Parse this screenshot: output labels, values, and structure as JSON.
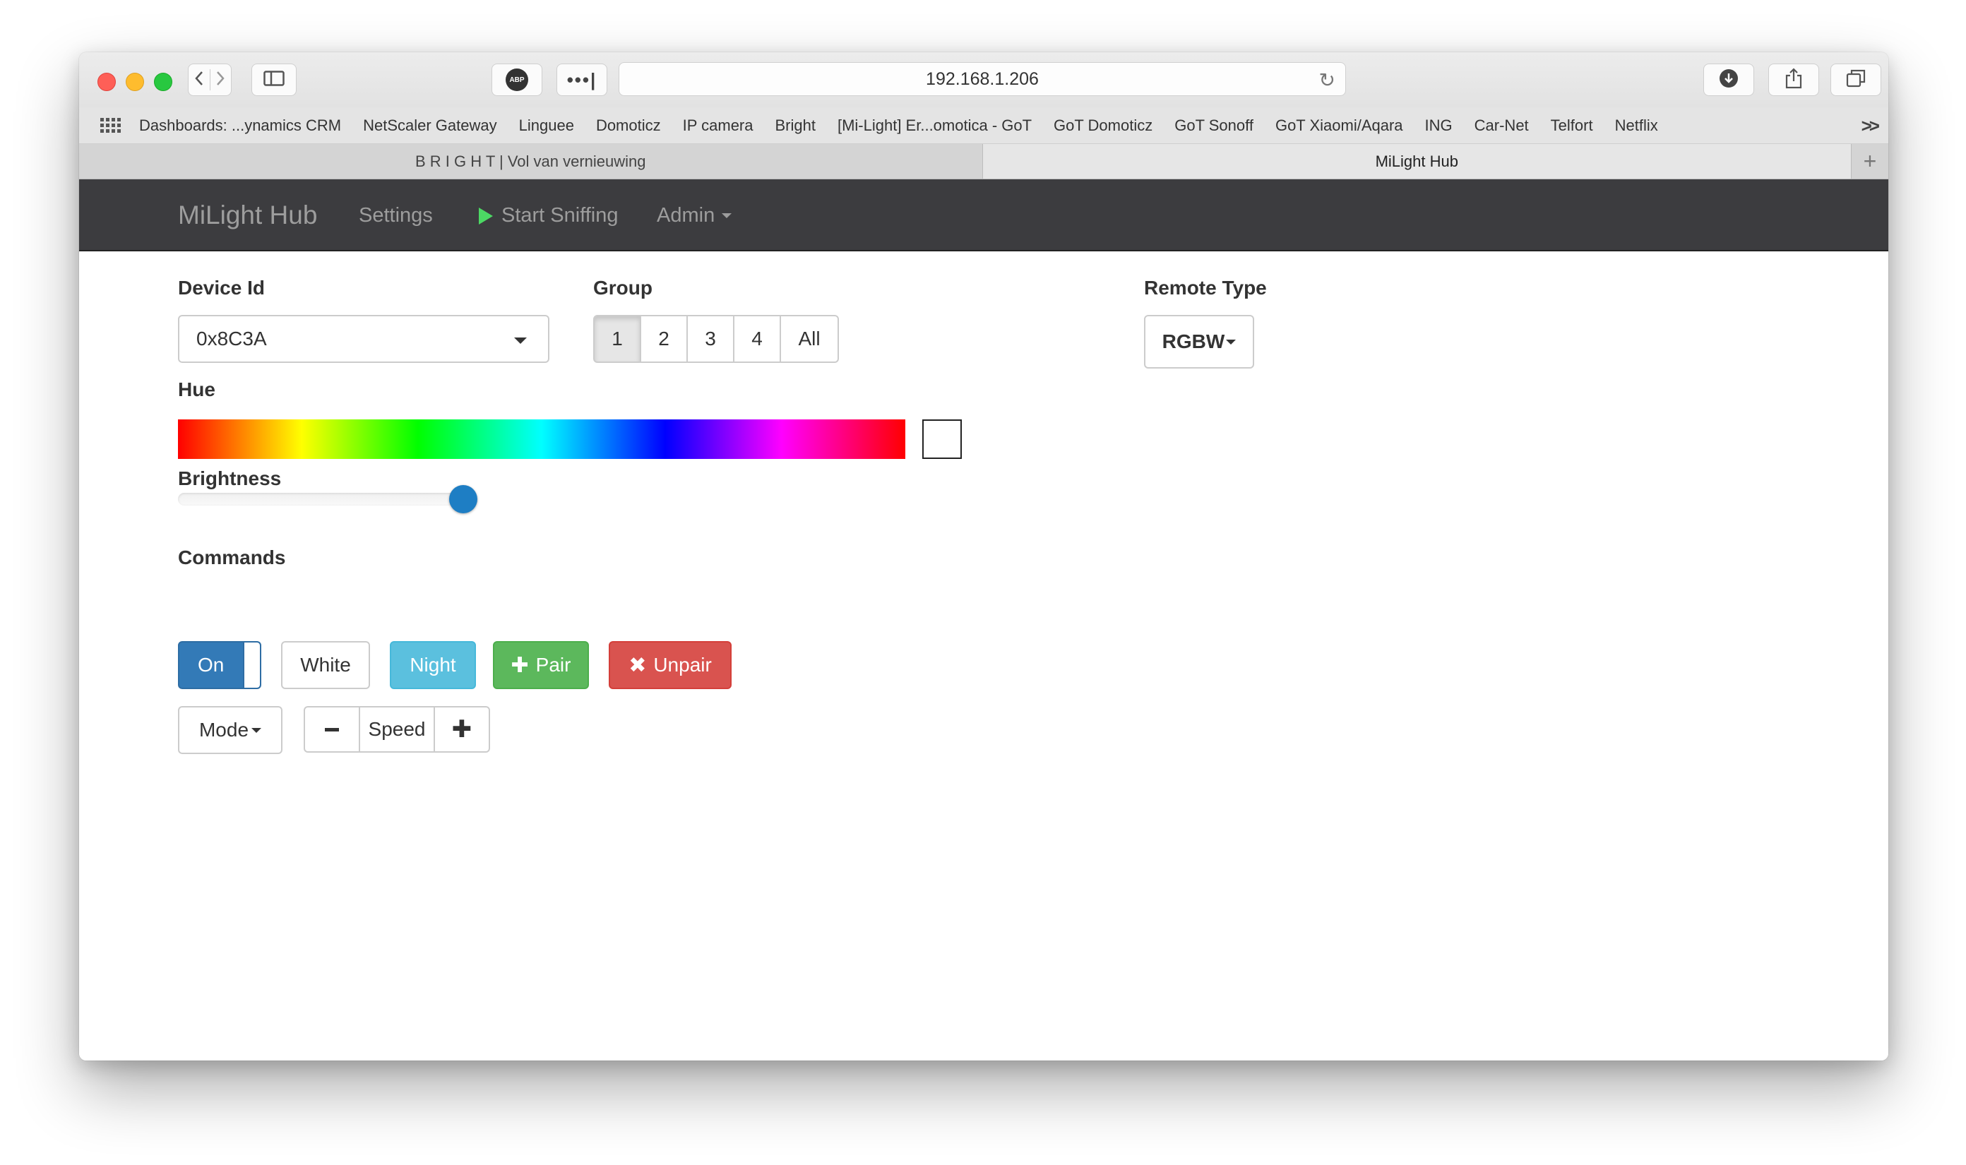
{
  "browser": {
    "url": "192.168.1.206",
    "bookmarks": [
      "Dashboards: ...ynamics CRM",
      "NetScaler Gateway",
      "Linguee",
      "Domoticz",
      "IP camera",
      "Bright",
      "[Mi-Light] Er...omotica - GoT",
      "GoT Domoticz",
      "GoT Sonoff",
      "GoT Xiaomi/Aqara",
      "ING",
      "Car-Net",
      "Telfort",
      "Netflix"
    ],
    "more_bookmarks": ">>",
    "tabs": [
      {
        "title": "B R I G H T | Vol van vernieuwing",
        "active": false
      },
      {
        "title": "MiLight Hub",
        "active": true
      }
    ],
    "adblock_label": "ABP"
  },
  "nav": {
    "brand": "MiLight Hub",
    "settings": "Settings",
    "sniff": "Start Sniffing",
    "admin": "Admin"
  },
  "form": {
    "device_id_label": "Device Id",
    "device_id_value": "0x8C3A",
    "group_label": "Group",
    "groups": [
      "1",
      "2",
      "3",
      "4",
      "All"
    ],
    "active_group": "1",
    "remote_type_label": "Remote Type",
    "remote_type_value": "RGBW",
    "hue_label": "Hue",
    "brightness_label": "Brightness",
    "brightness_value": 1.0,
    "commands_label": "Commands",
    "commands": {
      "on": "On",
      "white": "White",
      "night": "Night",
      "pair": "Pair",
      "unpair": "Unpair",
      "mode": "Mode",
      "speed": "Speed"
    }
  },
  "colors": {
    "primary": "#337ab7",
    "info": "#5bc0de",
    "success": "#5cb85c",
    "danger": "#d9534f",
    "navbar": "#3c3c3f",
    "slider_handle": "#1e7ec4"
  }
}
